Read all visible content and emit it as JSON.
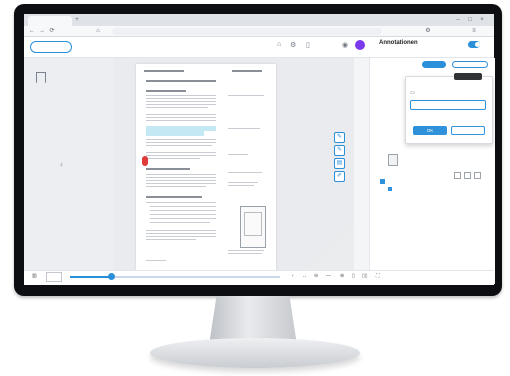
{
  "browser": {
    "tab_title": "",
    "url": ""
  },
  "app": {
    "back_label": "",
    "doc_title": "",
    "doc_subtitle": "",
    "annotations_title": "Annotationen",
    "annotations_toggle_label": "",
    "zoom_label": "",
    "user_code": "",
    "user_initial": ""
  },
  "panel": {
    "tab_labels": "",
    "new_button": "",
    "export_button": "",
    "dialog_title": "",
    "dialog_tooltip": "",
    "dialog_input_value": "",
    "dialog_ok": "OK",
    "dialog_cancel": "",
    "note_header": "",
    "note_author": "",
    "note_text": ""
  },
  "footer": {
    "page_current": "",
    "page_total": ""
  },
  "colors": {
    "accent": "#2a8fd9",
    "highlight": "#c5e8f5",
    "pin": "#e03a3a",
    "avatar": "#7c3aed"
  }
}
